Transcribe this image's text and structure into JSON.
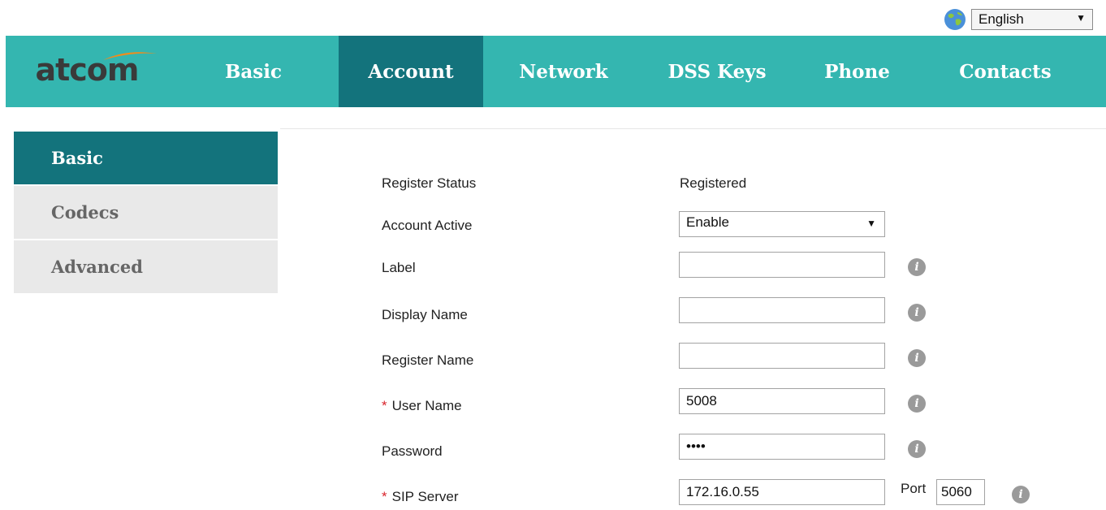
{
  "language": {
    "selected": "English"
  },
  "brand": {
    "logo_text": "atcom",
    "accent": "#34b6b0",
    "active": "#13737c"
  },
  "nav": [
    {
      "label": "Basic"
    },
    {
      "label": "Account"
    },
    {
      "label": "Network"
    },
    {
      "label": "DSS Keys"
    },
    {
      "label": "Phone"
    },
    {
      "label": "Contacts"
    }
  ],
  "sidebar": [
    {
      "label": "Basic"
    },
    {
      "label": "Codecs"
    },
    {
      "label": "Advanced"
    }
  ],
  "form": {
    "register_status": {
      "label": "Register Status",
      "value": "Registered"
    },
    "account_active": {
      "label": "Account Active",
      "value": "Enable"
    },
    "label": {
      "label": "Label",
      "value": ""
    },
    "display_name": {
      "label": "Display Name",
      "value": ""
    },
    "register_name": {
      "label": "Register Name",
      "value": ""
    },
    "user_name": {
      "label": "User Name",
      "value": "5008",
      "required": "*"
    },
    "password": {
      "label": "Password",
      "value": "••••"
    },
    "sip_server": {
      "label": "SIP Server",
      "value": "172.16.0.55",
      "required": "*",
      "port_label": "Port",
      "port": "5060"
    }
  }
}
